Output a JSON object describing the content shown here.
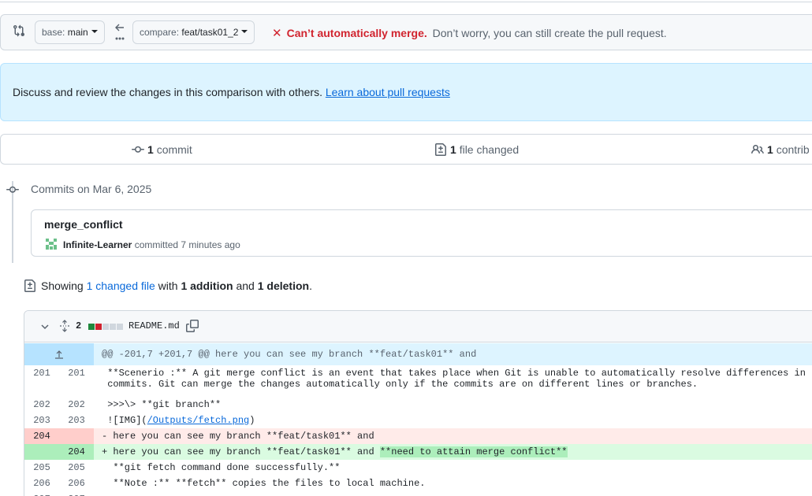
{
  "compare": {
    "base_label": "base:",
    "base_value": "main",
    "compare_label": "compare:",
    "compare_value": "feat/task01_2",
    "status_title": "Can’t automatically merge.",
    "status_text": "Don’t worry, you can still create the pull request."
  },
  "info": {
    "text": "Discuss and review the changes in this comparison with others.",
    "link": "Learn about pull requests"
  },
  "summary": {
    "commits_count": "1",
    "commits_label": "commit",
    "files_count": "1",
    "files_label": "file changed",
    "contributors_count": "1",
    "contributors_label": "contrib"
  },
  "timeline": {
    "date_heading": "Commits on Mar 6, 2025",
    "commit_title": "merge_conflict",
    "author": "Infinite-Learner",
    "action": "committed 7 minutes ago"
  },
  "showing": {
    "prefix": "Showing",
    "changed_link": "1 changed file",
    "with": "with",
    "additions": "1 addition",
    "and": "and",
    "deletions": "1 deletion",
    "suffix": "."
  },
  "file": {
    "changes_count": "2",
    "name": "README.md",
    "colors": {
      "add": "#1f883d",
      "del": "#cf222e",
      "neutral": "#d0d7de"
    },
    "blocks": [
      "add",
      "del",
      "neutral",
      "neutral",
      "neutral"
    ],
    "hunk_header": "@@ -201,7 +201,7 @@ here you can see my branch **feat/task01** and",
    "lines": {
      "l201": {
        "old": "201",
        "new": "201",
        "text1": " **Scenerio :** A git merge conflict is an event that takes place when Git is unable to automatically resolve differences in",
        "text2": " commits. Git can merge the changes automatically only if the commits are on different lines or branches."
      },
      "l202": {
        "old": "202",
        "new": "202",
        "text": " >>>\\> **git branch**"
      },
      "l203": {
        "old": "203",
        "new": "203",
        "pre": " ![IMG](",
        "link": "/Outputs/fetch.png",
        "post": ")"
      },
      "l204del": {
        "old": "204",
        "marker": "-",
        "text": " here you can see my branch **feat/task01** and"
      },
      "l204add": {
        "new": "204",
        "marker": "+",
        "text": " here you can see my branch **feat/task01** and ",
        "highlight": "**need to attain merge conflict**"
      },
      "l205": {
        "old": "205",
        "new": "205",
        "text": "  **git fetch command done successfully.**"
      },
      "l206": {
        "old": "206",
        "new": "206",
        "text": "  **Note :** **fetch** copies the files to local machine."
      },
      "l207": {
        "old": "207",
        "new": "207",
        "text": ""
      }
    }
  }
}
